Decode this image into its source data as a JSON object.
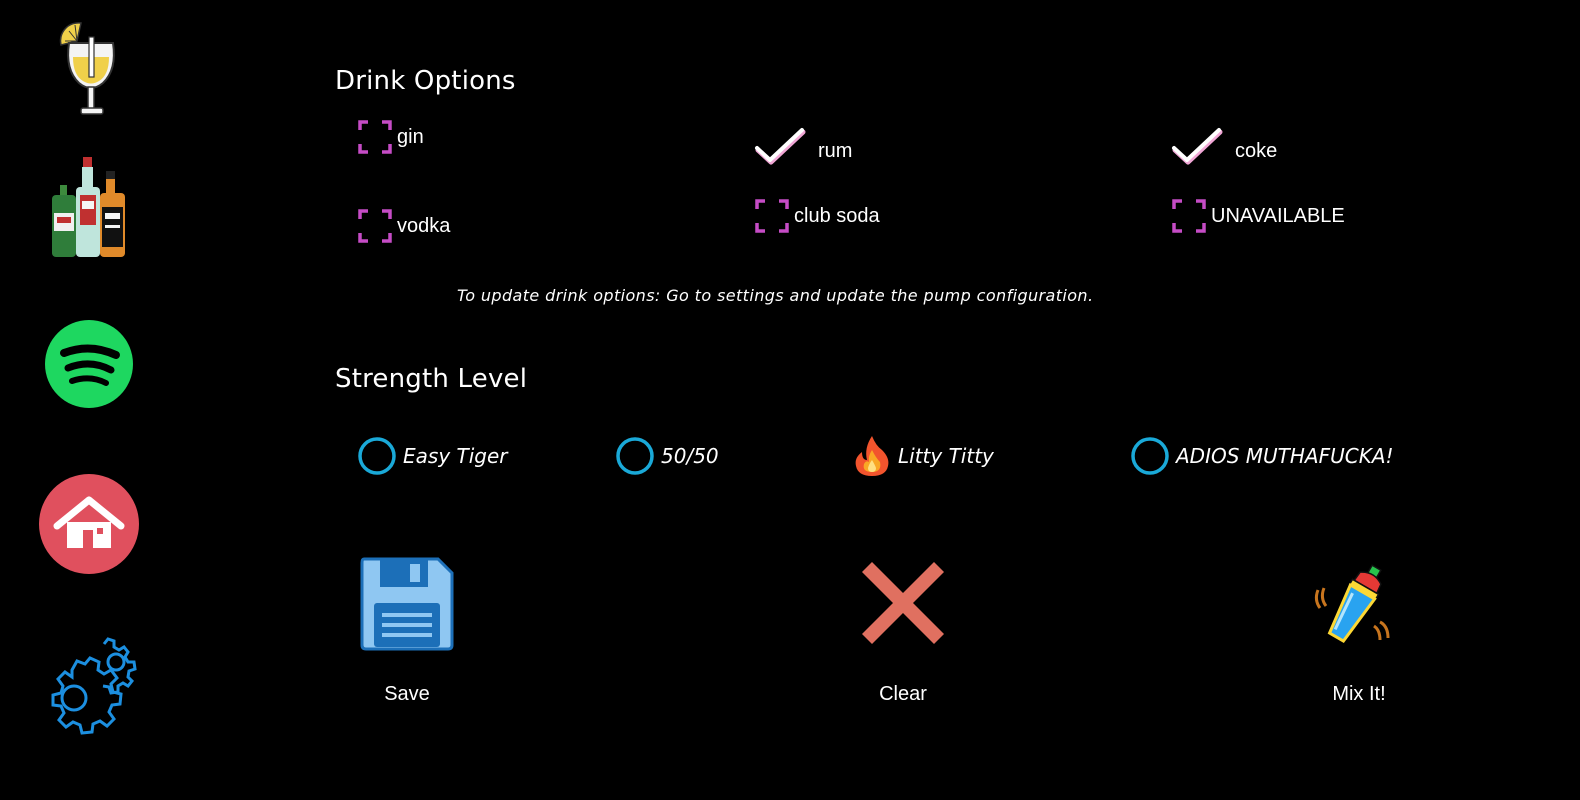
{
  "sidebar": {
    "items": [
      {
        "icon": "cocktail-glass-icon"
      },
      {
        "icon": "liquor-bottles-icon"
      },
      {
        "icon": "spotify-icon"
      },
      {
        "icon": "home-icon"
      },
      {
        "icon": "settings-gear-icon"
      }
    ]
  },
  "drink_options": {
    "title": "Drink Options",
    "options": [
      {
        "label": "gin",
        "checked": false
      },
      {
        "label": "rum",
        "checked": true
      },
      {
        "label": "coke",
        "checked": true
      },
      {
        "label": "vodka",
        "checked": false
      },
      {
        "label": "club soda",
        "checked": false
      },
      {
        "label": "UNAVAILABLE",
        "checked": false
      }
    ],
    "hint": "To update drink options: Go to settings and update the pump configuration."
  },
  "strength": {
    "title": "Strength Level",
    "levels": [
      {
        "label": "Easy Tiger",
        "selected": false
      },
      {
        "label": "50/50",
        "selected": false
      },
      {
        "label": "Litty Titty",
        "selected": true
      },
      {
        "label": "ADIOS MUTHAFUCKA!",
        "selected": false
      }
    ]
  },
  "actions": {
    "save_label": "Save",
    "clear_label": "Clear",
    "mix_label": "Mix It!"
  },
  "colors": {
    "background": "#000000",
    "checkbox_unchecked": "#c64cc6",
    "radio_ring": "#1aa9d8",
    "clear_x": "#e07060",
    "home_circle": "#e0505e",
    "spotify_green": "#1ed760",
    "gear_blue": "#1c8fe0"
  }
}
